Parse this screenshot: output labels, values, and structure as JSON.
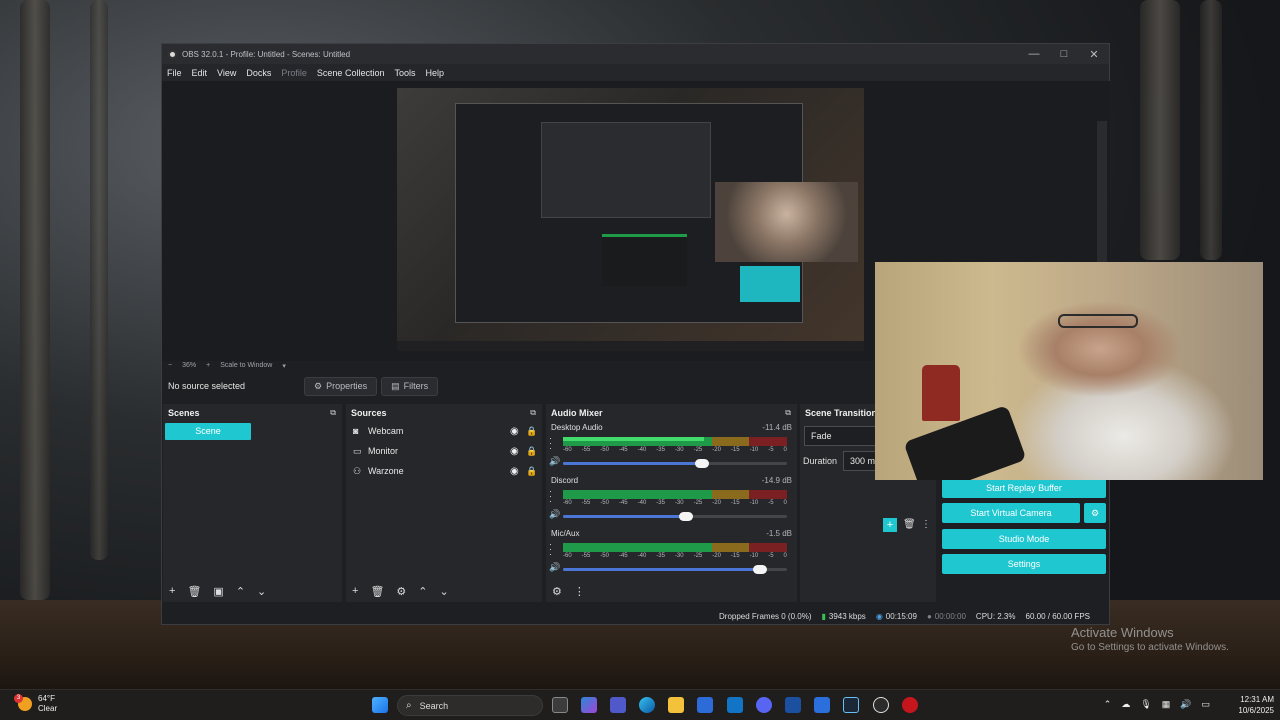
{
  "window": {
    "title": "OBS 32.0.1 - Profile: Untitled - Scenes: Untitled",
    "controls": [
      "—",
      "□",
      "✕"
    ]
  },
  "menu": [
    "File",
    "Edit",
    "View",
    "Docks",
    "Profile",
    "Scene Collection",
    "Tools",
    "Help"
  ],
  "zoom": {
    "minus": "−",
    "value": "36%",
    "plus": "+",
    "mode": "Scale to Window"
  },
  "source_toolbar": {
    "no_source": "No source selected",
    "properties": "Properties",
    "filters": "Filters"
  },
  "scenes": {
    "title": "Scenes",
    "items": [
      "Scene"
    ]
  },
  "sources": {
    "title": "Sources",
    "items": [
      {
        "name": "Webcam",
        "icon": "camera-icon"
      },
      {
        "name": "Monitor",
        "icon": "monitor-icon"
      },
      {
        "name": "Warzone",
        "icon": "gamepad-icon"
      }
    ]
  },
  "mixer": {
    "title": "Audio Mixer",
    "ticks": [
      "-60",
      "-55",
      "-50",
      "-45",
      "-40",
      "-35",
      "-30",
      "-25",
      "-20",
      "-15",
      "-10",
      "-5",
      "0"
    ],
    "channels": [
      {
        "name": "Desktop Audio",
        "db": "-11.4 dB",
        "level": 0.63,
        "volume": 0.62
      },
      {
        "name": "Discord",
        "db": "-14.9 dB",
        "level": 0.0,
        "volume": 0.55
      },
      {
        "name": "Mic/Aux",
        "db": "-1.5 dB",
        "level": 0.0,
        "volume": 0.88
      }
    ]
  },
  "transitions": {
    "title": "Scene Transitions",
    "selected": "Fade",
    "duration_label": "Duration",
    "duration_value": "300 ms"
  },
  "controls": {
    "replay": "Start Replay Buffer",
    "virtual_cam": "Start Virtual Camera",
    "studio": "Studio Mode",
    "settings": "Settings"
  },
  "status": {
    "dropped": "Dropped Frames 0 (0.0%)",
    "bitrate": "3943 kbps",
    "stream_time": "00:15:09",
    "rec_time": "00:00:00",
    "cpu": "CPU: 2.3%",
    "fps": "60.00 / 60.00 FPS"
  },
  "watermark": {
    "line1": "Activate Windows",
    "line2": "Go to Settings to activate Windows."
  },
  "taskbar": {
    "weather_temp": "64°F",
    "weather_desc": "Clear",
    "weather_badge": "3",
    "search_placeholder": "Search",
    "time": "12:31 AM",
    "date": "10/6/2025"
  },
  "colors": {
    "accent": "#1fc7d0",
    "meter_green": "#1f9a49",
    "meter_yellow": "#8a6a1d",
    "meter_red": "#7a2022"
  }
}
